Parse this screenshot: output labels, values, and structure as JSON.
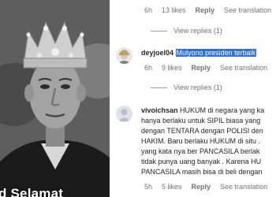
{
  "photo": {
    "caption": "d Selamat"
  },
  "comments": [
    {
      "meta": {
        "time": "6h",
        "likes": "13 likes",
        "reply": "Reply",
        "translate": "See translation"
      },
      "view_replies": "View replies (1)"
    },
    {
      "username": "deyjoel04",
      "text_lines": [
        "Mulyono presiden terbaik"
      ],
      "meta": {
        "time": "6h",
        "likes": "9 likes",
        "reply": "Reply",
        "translate": "See translation"
      },
      "view_replies": "View replies (1)"
    },
    {
      "username": "vivoichsan",
      "text_first": "HUKUM di negara yang ka",
      "text_lines": [
        "hanya berlaku untuk SIPIL biasa yang",
        "dengan TENTARA dengan POLISI den",
        "HAKIM. Baru berlaku HUKUM di situ .",
        "yang kata nya ber PANCASILA berlak",
        "tidak punya uang banyak . Karena HU",
        "PANCASILA masih bisa di beli dengan"
      ],
      "meta": {
        "time": "5h",
        "likes": "5 likes",
        "reply": "Reply",
        "translate": "See translation"
      }
    }
  ]
}
